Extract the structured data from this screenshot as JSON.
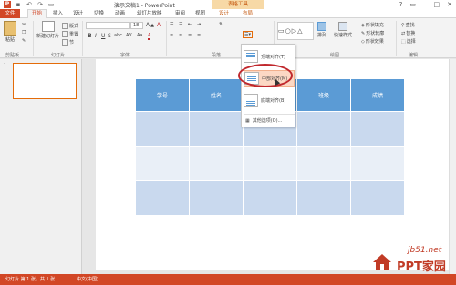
{
  "title_bar": {
    "app_logo": "P",
    "doc_title": "演示文稿1 - PowerPoint",
    "context_tool": "表格工具",
    "window_controls": [
      "?",
      "▭",
      "–",
      "□",
      "✕"
    ]
  },
  "tabs": [
    "文件",
    "开始",
    "插入",
    "设计",
    "切换",
    "动画",
    "幻灯片放映",
    "审阅",
    "视图",
    "设计",
    "布局"
  ],
  "ribbon": {
    "paste": "粘贴",
    "new_slide": "新建幻灯片",
    "layout": "版式",
    "reset": "重置",
    "section": "节",
    "font_box": "",
    "font_size": "18",
    "bold": "B",
    "italic": "I",
    "underline": "U",
    "strike": "S",
    "shadow_abc": "abc",
    "char_space": "AV",
    "case": "Aa",
    "fontcolor": "A",
    "shape_fill": "形状填充",
    "shape_outline": "形状轮廓",
    "shape_effects": "形状效果",
    "quick_styles": "快速样式",
    "arrange": "排列",
    "find": "查找",
    "replace": "替换",
    "select": "选择",
    "groups": [
      "剪贴板",
      "幻灯片",
      "字体",
      "段落",
      "绘图",
      "编辑"
    ]
  },
  "slide_panel": {
    "number": "1"
  },
  "table": {
    "headers": [
      "学号",
      "姓名",
      "",
      "班级",
      "成绩"
    ],
    "rows": [
      [
        "",
        "",
        "",
        "",
        ""
      ],
      [
        "",
        "",
        "",
        "",
        ""
      ],
      [
        "",
        "",
        "",
        "",
        ""
      ]
    ],
    "colors": {
      "header": "#5b9bd5",
      "band_dark": "#c9d9ee",
      "band_light": "#e9eff7"
    }
  },
  "dropdown": {
    "items": [
      "顶端对齐(T)",
      "中部对齐(M)",
      "底端对齐(B)"
    ],
    "highlighted_index": 1,
    "more": "其他选项(O)..."
  },
  "status_bar": {
    "slide_info": "幻灯片 第 1 张，共 1 张",
    "lang": "中文(中国)",
    "accent": "#d24726"
  },
  "watermark": {
    "site": "jb51.net",
    "brand": "PPT家园"
  }
}
